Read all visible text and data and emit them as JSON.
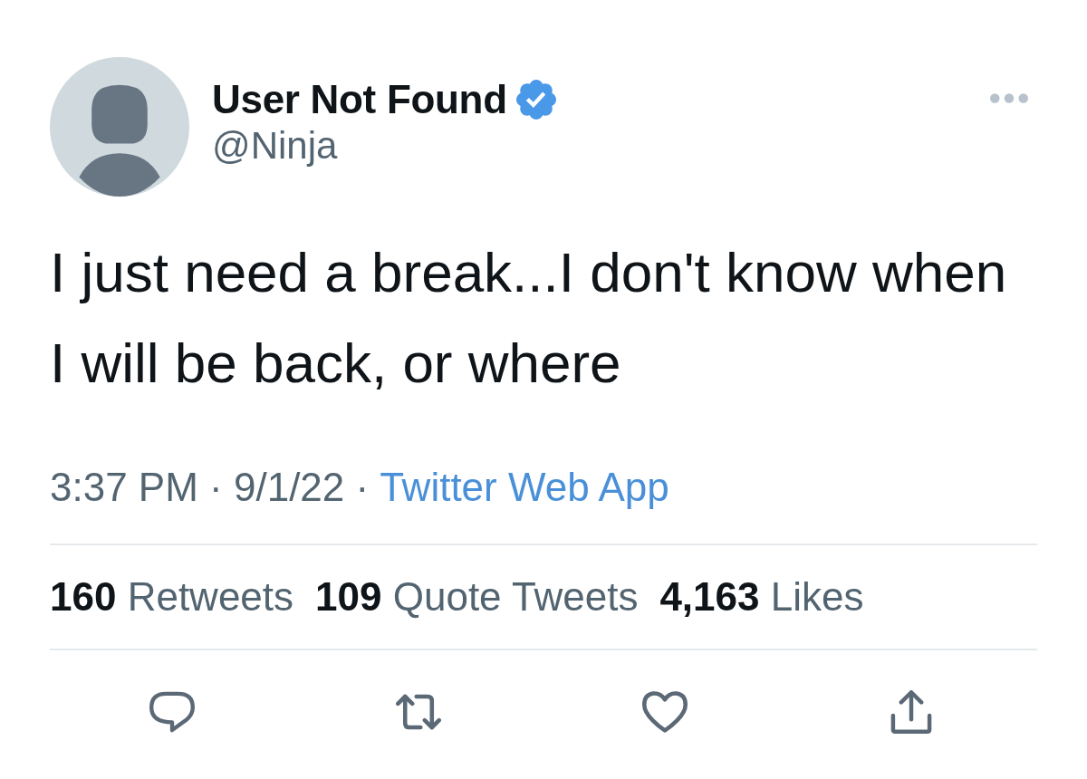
{
  "author": {
    "name": "User Not Found",
    "verified": true,
    "handle": "@Ninja"
  },
  "tweet": {
    "text": "I just need a break...I don't know when I will be back, or where"
  },
  "meta": {
    "timestamp": "3:37 PM · 9/1/22 ·",
    "source": "Twitter Web App"
  },
  "stats": [
    {
      "count": "160",
      "label": "Retweets"
    },
    {
      "count": "109",
      "label": "Quote Tweets"
    },
    {
      "count": "4,163",
      "label": "Likes"
    }
  ]
}
